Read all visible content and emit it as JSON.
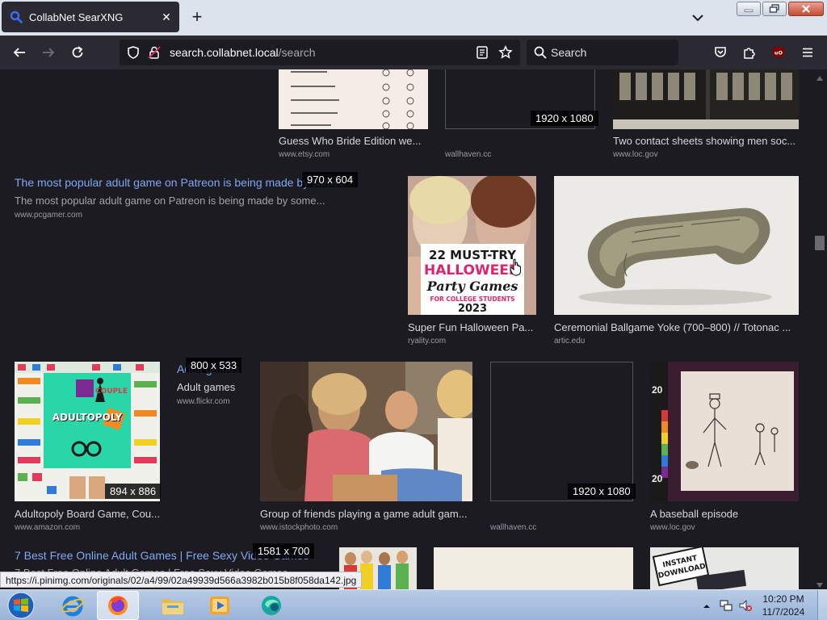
{
  "browser": {
    "tab_title": "CollabNet SearXNG",
    "new_tab_label": "+",
    "url_host": "search.collabnet.local",
    "url_path": "/search",
    "search_placeholder": "Search"
  },
  "results_row1": [
    {
      "title": "Guess Who Bride Edition we...",
      "source": "www.etsy.com"
    },
    {
      "title": "",
      "source": "wallhaven.cc",
      "dims": "1920 x 1080"
    },
    {
      "title": "Two contact sheets showing men soc...",
      "source": "www.loc.gov"
    }
  ],
  "link_result_1": {
    "title": "The most popular adult game on Patreon is being made by some...",
    "description": "The most popular adult game on Patreon is being made by some...",
    "source": "www.pcgamer.com",
    "dims": "970 x 604"
  },
  "results_row2": [
    {
      "title": "Super Fun Halloween Pa...",
      "source": "ryality.com",
      "poster_line1": "22 MUST-TRY",
      "poster_line2": "HALLOWEEN",
      "poster_line3": "Party Games",
      "poster_line4": "FOR COLLEGE STUDENTS",
      "poster_line5": "2023"
    },
    {
      "title": "Ceremonial Ballgame Yoke (700–800) // Totonac ...",
      "source": "artic.edu"
    }
  ],
  "results_row3": [
    {
      "title": "Adultopoly Board Game, Cou...",
      "source": "www.amazon.com",
      "dims": "894 x 886",
      "board_couple": "COUPLE",
      "board_name": "ADULTOPOLY"
    },
    {
      "title": "Adult games",
      "subtitle": "Adult games",
      "source": "www.flickr.com",
      "dims": "800 x 533"
    },
    {
      "title": "Group of friends playing a game adult gam...",
      "source": "www.istockphoto.com"
    },
    {
      "title": "",
      "source": "wallhaven.cc",
      "dims": "1920 x 1080"
    },
    {
      "title": "A baseball episode",
      "source": "www.loc.gov",
      "ruler_top": "20",
      "ruler_bottom": "20"
    }
  ],
  "link_result_2": {
    "title": "7 Best Free Online Adult Games | Free Sexy Video Games",
    "description": "7 Best Free Online Adult Games | Free Sexy Video Games...",
    "dims": "1581 x 700",
    "instant_label": "INSTANT DOWNLOAD"
  },
  "status_url": "https://i.pinimg.com/originals/02/a4/99/02a49939d566a3982b015b8f058da142.jpg",
  "taskbar": {
    "time": "10:20 PM",
    "date": "11/7/2024"
  },
  "colors": {
    "background": "#1c1b22",
    "link": "#7fa8f4",
    "toolbar": "#2b2a33"
  }
}
